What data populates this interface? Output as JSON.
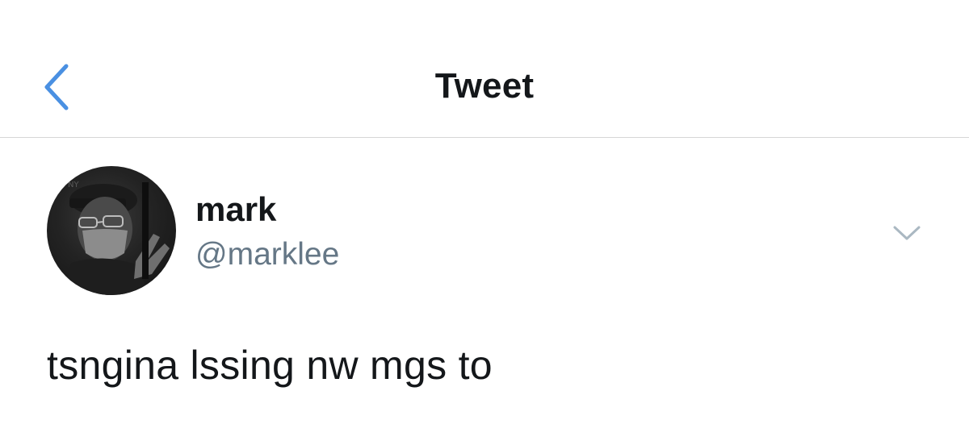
{
  "header": {
    "title": "Tweet",
    "back_icon": "chevron-left-icon"
  },
  "tweet": {
    "author": {
      "display_name": "mark",
      "handle": "@marklee",
      "avatar_icon": "avatar-photo"
    },
    "more_icon": "chevron-down-icon",
    "text": "tsngina lssing nw mgs to"
  },
  "colors": {
    "accent": "#4a90e2",
    "text_primary": "#14171a",
    "text_secondary": "#657786",
    "divider": "#d6d6d6",
    "chevron_grey": "#aab8c2"
  }
}
